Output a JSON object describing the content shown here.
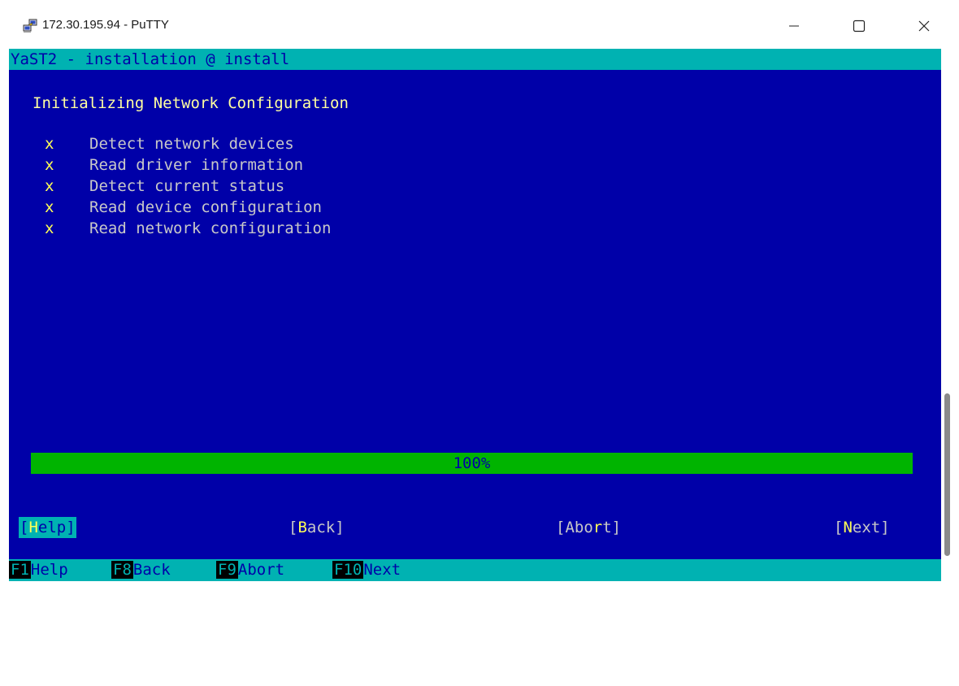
{
  "window": {
    "title": "172.30.195.94 - PuTTY",
    "app_icon": "putty-computers-icon"
  },
  "terminal": {
    "header": "YaST2 - installation @ install",
    "heading": "Initializing Network Configuration",
    "tasks": [
      {
        "mark": "x",
        "label": "Detect network devices"
      },
      {
        "mark": "x",
        "label": "Read driver information"
      },
      {
        "mark": "x",
        "label": "Detect current status"
      },
      {
        "mark": "x",
        "label": "Read device configuration"
      },
      {
        "mark": "x",
        "label": "Read network configuration"
      }
    ],
    "progress": {
      "percent": 100,
      "label": "100%"
    },
    "buttons": {
      "help": {
        "open": "[",
        "hot": "H",
        "rest": "elp",
        "close": "]"
      },
      "back": {
        "open": "[",
        "hot": "B",
        "rest": "ack",
        "close": "]"
      },
      "abort": {
        "open": "[Abo",
        "hot": "r",
        "rest": "t",
        "close": "]"
      },
      "next": {
        "open": "[",
        "hot": "N",
        "rest": "ext",
        "close": "]"
      }
    },
    "fkeys": [
      {
        "key": "F1",
        "label": "Help"
      },
      {
        "key": "F8",
        "label": "Back"
      },
      {
        "key": "F9",
        "label": "Abort"
      },
      {
        "key": "F10",
        "label": "Next"
      }
    ]
  },
  "colors": {
    "background": "#0000a8",
    "bar": "#00b2b2",
    "progress": "#00b400",
    "highlight": "#ffff55"
  }
}
